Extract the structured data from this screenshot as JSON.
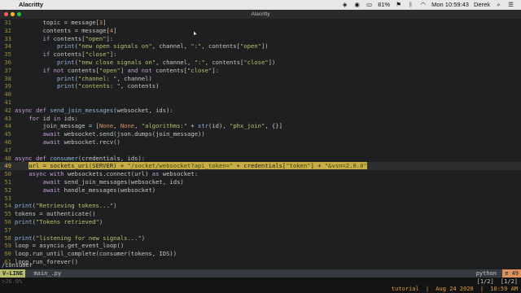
{
  "menubar": {
    "app_name": "Alacritty",
    "battery": "81%",
    "clock": "Mon 10:59:43",
    "user": "Derek"
  },
  "window": {
    "title": "Alacritty"
  },
  "editor": {
    "current_line": 49,
    "lines": [
      {
        "n": "31",
        "html": "        topic = message[<span class='num'>3</span>]"
      },
      {
        "n": "32",
        "html": "        contents = message[<span class='num'>4</span>]"
      },
      {
        "n": "33",
        "html": "        <span class='kw'>if</span> contents[<span class='str'>\"open\"</span>]:"
      },
      {
        "n": "34",
        "html": "            <span class='fn'>print</span>(<span class='str'>\"new open signals on\"</span>, channel, <span class='str'>\":\"</span>, contents[<span class='str'>\"open\"</span>])"
      },
      {
        "n": "35",
        "html": "        <span class='kw'>if</span> contents[<span class='str'>\"close\"</span>]:"
      },
      {
        "n": "36",
        "html": "            <span class='fn'>print</span>(<span class='str'>\"new close signals on\"</span>, channel, <span class='str'>\":\"</span>, contents[<span class='str'>\"close\"</span>])"
      },
      {
        "n": "37",
        "html": "        <span class='kw'>if not</span> contents[<span class='str'>\"open\"</span>] <span class='kw'>and not</span> contents[<span class='str'>\"close\"</span>]:"
      },
      {
        "n": "38",
        "html": "            <span class='fn'>print</span>(<span class='str'>\"channel: \"</span>, channel)"
      },
      {
        "n": "39",
        "html": "            <span class='fn'>print</span>(<span class='str'>\"contents: \"</span>, contents)"
      },
      {
        "n": "40",
        "html": ""
      },
      {
        "n": "41",
        "html": ""
      },
      {
        "n": "42",
        "html": "<span class='kw'>async def</span> <span class='fn'>send_join_messages</span>(websocket, ids):"
      },
      {
        "n": "43",
        "html": "    <span class='kw'>for</span> id <span class='kw'>in</span> ids:"
      },
      {
        "n": "44",
        "html": "        join_message = [<span class='num'>None</span>, <span class='num'>None</span>, <span class='str'>\"algorithms:\"</span> + <span class='fn'>str</span>(id), <span class='str'>\"phx_join\"</span>, {}]"
      },
      {
        "n": "45",
        "html": "        <span class='kw'>await</span> websocket.send(json.dumps(join_message))"
      },
      {
        "n": "46",
        "html": "        <span class='kw'>await</span> websocket.recv()"
      },
      {
        "n": "47",
        "html": ""
      },
      {
        "n": "48",
        "html": "<span class='kw'>async def</span> <span class='fn'>consumer</span>(credentials, ids):"
      },
      {
        "n": "49",
        "html": "    <span class='sel'>url = sockets_uri(SERVER) + </span><span class='sel-str'>\"/socket/websocket?api_token=\"</span><span class='sel'> + credentials[</span><span class='sel-str'>\"token\"</span><span class='sel'>] + </span><span class='sel-str'>\"&amp;vsn=2.0.0\"</span>"
      },
      {
        "n": "50",
        "html": "    <span class='kw'>async with</span> websockets.connect(url) <span class='kw'>as</span> websocket:"
      },
      {
        "n": "51",
        "html": "        <span class='kw'>await</span> send_join_messages(websocket, ids)"
      },
      {
        "n": "52",
        "html": "        <span class='kw'>await</span> handle_messages(websocket)"
      },
      {
        "n": "53",
        "html": ""
      },
      {
        "n": "54",
        "html": "<span class='fn'>print</span>(<span class='str'>\"Retrieving tokens...\"</span>)"
      },
      {
        "n": "55",
        "html": "tokens = authenticate()"
      },
      {
        "n": "56",
        "html": "<span class='fn'>print</span>(<span class='str'>\"Tokens retrieved\"</span>)"
      },
      {
        "n": "57",
        "html": ""
      },
      {
        "n": "58",
        "html": "<span class='fn'>print</span>(<span class='str'>\"listening for new signals...\"</span>)"
      },
      {
        "n": "59",
        "html": "loop = asyncio.get_event_loop()"
      },
      {
        "n": "60",
        "html": "loop.run_until_complete(consumer(tokens, IDS))"
      },
      {
        "n": "61",
        "html": "loop.run_forever()"
      }
    ]
  },
  "cmdline": "/consumer",
  "statusbar": {
    "mode": "V-LINE",
    "buffer": "main_.py",
    "filetype": "python",
    "position": "49"
  },
  "tmux": {
    "prompt": ">26.0%",
    "session": "tutorial",
    "date": "Aug 24 2020",
    "time": "10:59 AM",
    "pos_info": "[1/2]",
    "pos_info2": "[1/2]"
  },
  "colors": {
    "background": "#1d1f21",
    "selection": "#c8ad44",
    "mode_badge": "#b5bd68",
    "position_badge": "#de935f"
  }
}
